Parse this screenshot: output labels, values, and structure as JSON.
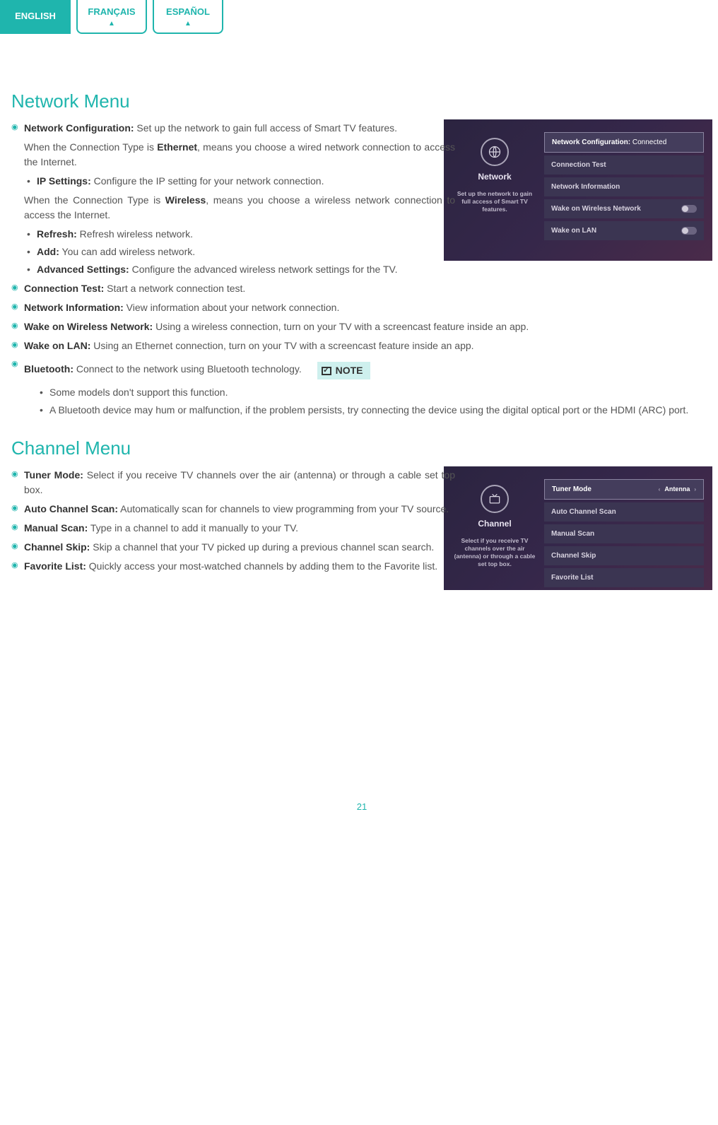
{
  "tabs": {
    "en": "ENGLISH",
    "fr": "FRANÇAIS",
    "es": "ESPAÑOL"
  },
  "network": {
    "title": "Network Menu",
    "config_label": "Network Configuration:",
    "config_desc": " Set up the network to gain full access of Smart TV features.",
    "ethernet_p1": "When the Connection Type is ",
    "ethernet_bold": "Ethernet",
    "ethernet_p2": ", means you choose a wired network connection to access the Internet.",
    "ip_label": "IP Settings:",
    "ip_desc": " Configure the IP setting for your network connection.",
    "wireless_p1": "When the Connection Type is ",
    "wireless_bold": "Wireless",
    "wireless_p2": ", means you choose a wireless network connection to access the Internet.",
    "refresh_label": "Refresh:",
    "refresh_desc": " Refresh wireless network.",
    "add_label": "Add:",
    "add_desc": " You can add wireless network.",
    "adv_label": "Advanced Settings:",
    "adv_desc": " Configure the advanced wireless network settings for the TV.",
    "conntest_label": "Connection Test:",
    "conntest_desc": " Start a network connection test.",
    "netinfo_label": "Network Information:",
    "netinfo_desc": " View information about your network connection.",
    "wow_label": "Wake on Wireless Network:",
    "wow_desc": " Using a wireless connection, turn on your TV with a screencast feature inside an app.",
    "wol_label": "Wake on LAN:",
    "wol_desc": " Using an Ethernet connection, turn on your TV with a screencast feature inside an app.",
    "bt_label": "Bluetooth:",
    "bt_desc": " Connect to the network using Bluetooth technology.",
    "note_label": "NOTE",
    "note1": "Some models don't support this function.",
    "note2": "A Bluetooth device may hum or malfunction, if the problem persists, try connecting the device using the digital optical port or the HDMI (ARC) port."
  },
  "network_panel": {
    "side_title": "Network",
    "side_desc": "Set up the network to gain full access of Smart TV features.",
    "row_config_label": "Network Configuration: ",
    "row_config_val": "Connected",
    "row_test": "Connection Test",
    "row_info": "Network Information",
    "row_wow": "Wake on Wireless Network",
    "row_wol": "Wake on LAN"
  },
  "channel": {
    "title": "Channel Menu",
    "tuner_label": "Tuner Mode:",
    "tuner_desc": " Select if you receive TV channels over the air (antenna) or through a cable set top box.",
    "auto_label": "Auto Channel Scan:",
    "auto_desc": " Automatically scan for channels to view programming from your TV source.",
    "manual_label": "Manual Scan:",
    "manual_desc": " Type in a channel to add it manually to your TV.",
    "skip_label": "Channel Skip:",
    "skip_desc": " Skip a channel that your TV picked up during a previous channel scan search.",
    "fav_label": "Favorite List:",
    "fav_desc": " Quickly access your most-watched channels by adding them to the Favorite list."
  },
  "channel_panel": {
    "side_title": "Channel",
    "side_desc": "Select if you receive TV channels over the air (antenna) or through a cable set top box.",
    "row_tuner": "Tuner Mode",
    "row_tuner_val": "Antenna",
    "row_auto": "Auto Channel Scan",
    "row_manual": "Manual Scan",
    "row_skip": "Channel Skip",
    "row_fav": "Favorite List"
  },
  "page_number": "21"
}
